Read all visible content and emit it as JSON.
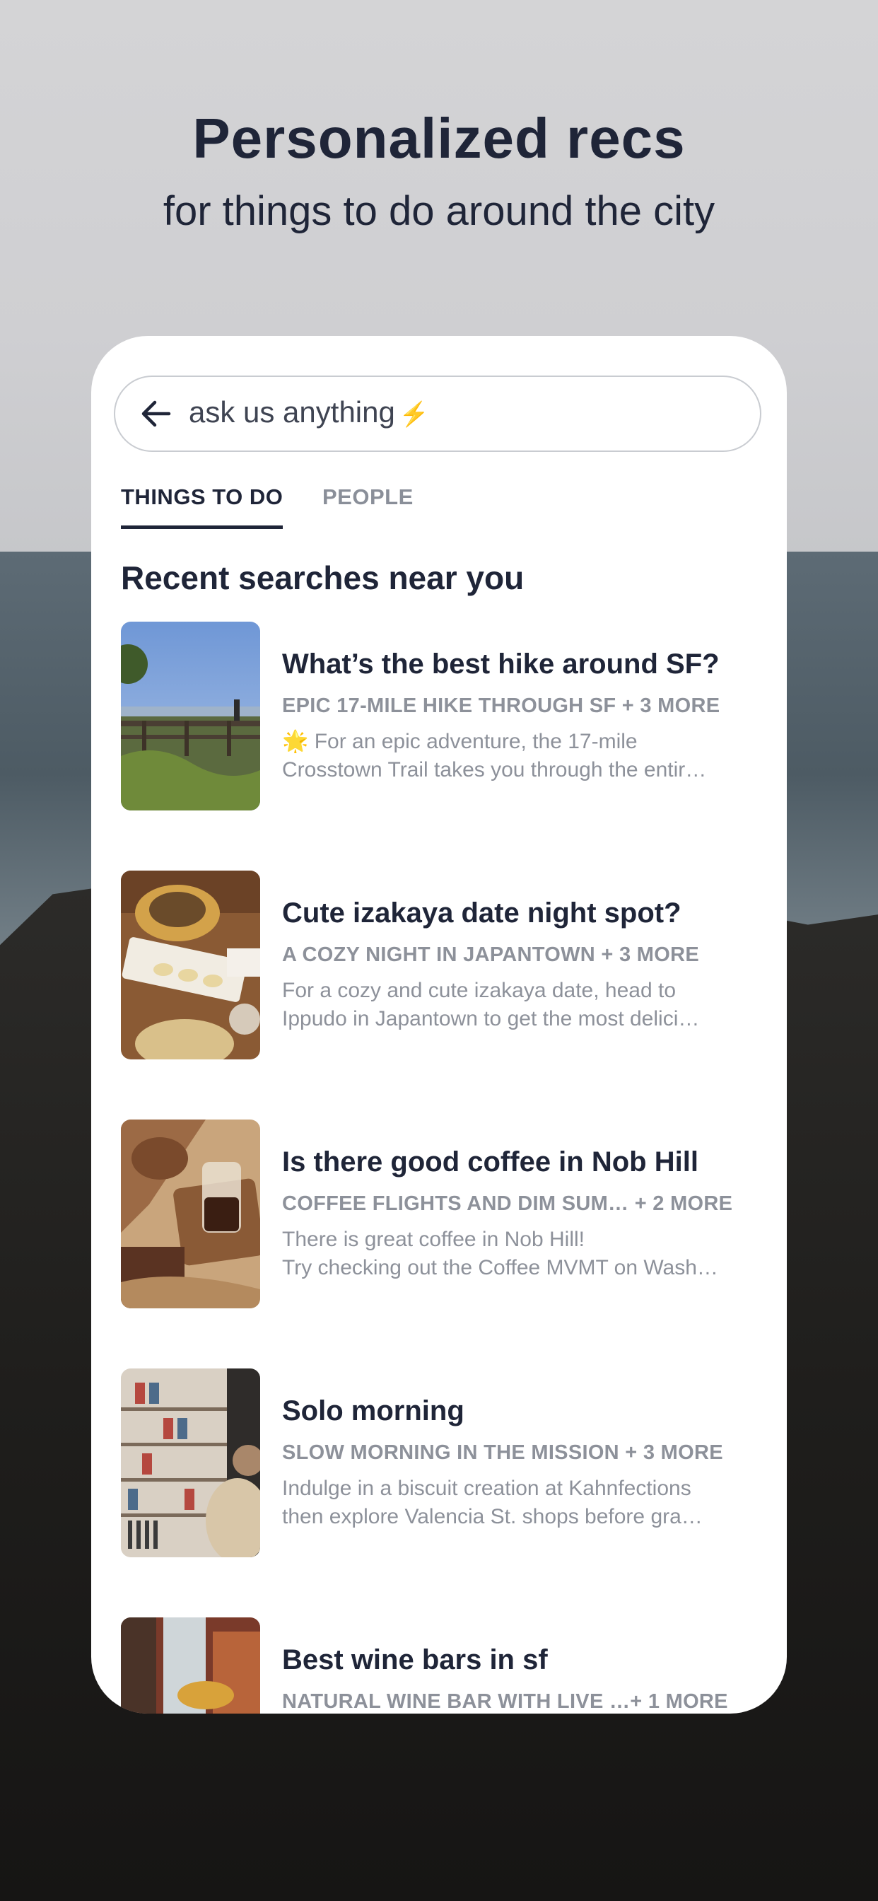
{
  "hero": {
    "title": "Personalized recs",
    "subtitle": "for things to do around the city"
  },
  "search": {
    "placeholder": "ask us anything",
    "bolt_glyph": "⚡",
    "back_icon": "arrow-left-icon"
  },
  "tabs": [
    {
      "label": "THINGS TO DO",
      "active": true
    },
    {
      "label": "PEOPLE",
      "active": false
    }
  ],
  "section_title": "Recent searches near you",
  "results": [
    {
      "title": "What’s the best hike around SF?",
      "subtitle": "EPIC 17-MILE HIKE THROUGH SF + 3 MORE",
      "desc_line1": "🌟 For an epic adventure, the 17-mile",
      "desc_line2": "Crosstown Trail takes you through the entir…",
      "thumb": "hike-photo"
    },
    {
      "title": "Cute izakaya date night spot?",
      "subtitle": "A COZY NIGHT IN JAPANTOWN + 3 MORE",
      "desc_line1": "For a cozy and cute izakaya date, head to",
      "desc_line2": "Ippudo in Japantown to get the most delici…",
      "thumb": "izakaya-photo"
    },
    {
      "title": "Is there good coffee in Nob Hill",
      "subtitle": "COFFEE FLIGHTS AND DIM SUM… + 2 MORE",
      "desc_line1": "There is great coffee in Nob Hill!",
      "desc_line2": "Try checking out the Coffee MVMT on Wash…",
      "thumb": "coffee-photo"
    },
    {
      "title": "Solo morning",
      "subtitle": "SLOW MORNING IN THE MISSION + 3 MORE",
      "desc_line1": "Indulge in a biscuit creation at Kahnfections",
      "desc_line2": "then explore Valencia St. shops before gra…",
      "thumb": "bookstore-photo"
    },
    {
      "title": "Best wine bars in sf",
      "subtitle": "NATURAL WINE BAR WITH LIVE …+ 1 MORE",
      "desc_line1": "",
      "desc_line2": "",
      "thumb": "wine-bar-photo"
    }
  ],
  "colors": {
    "ink": "#1f2538",
    "muted": "#8d919a",
    "card": "#ffffff"
  }
}
